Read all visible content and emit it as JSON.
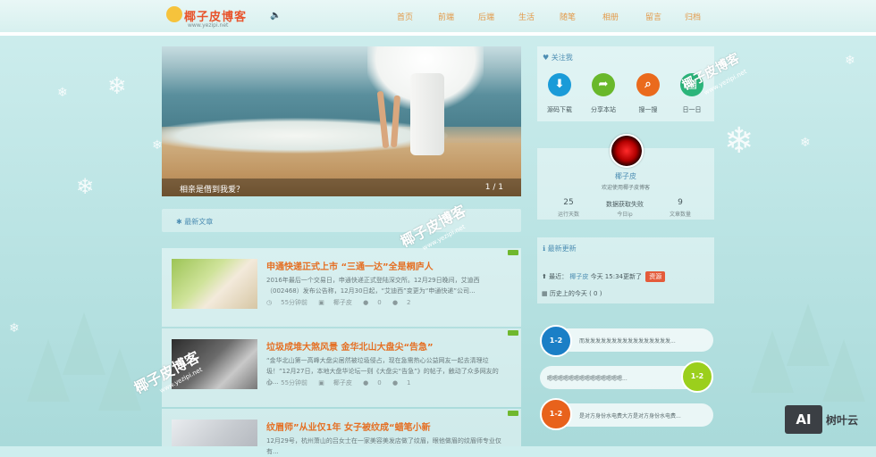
{
  "header": {
    "logo_text": "椰子皮博客",
    "logo_sub": "www.yezipi.net",
    "speaker_text": "🔈 ",
    "nav": [
      "首页",
      "前端",
      "后端",
      "生活",
      "随笔",
      "相册",
      "留言",
      "归档"
    ]
  },
  "slider": {
    "caption": "相亲是借到我爱？",
    "page": "1 / 1"
  },
  "latest": {
    "title": "最新文章"
  },
  "articles": [
    {
      "title": "申通快递正式上市 “三通一达”全是桐庐人",
      "excerpt": "2016年最后一个交易日，申通快递正式登陆深交所。12月29日晚间，艾迪西（002468）发布公告称，12月30日起，“艾迪西”变更为“申通快递”公司...",
      "time": "55分钟前",
      "author": "椰子皮",
      "comments": "0",
      "likes": "2"
    },
    {
      "title": "垃圾成堆大煞风景 金华北山大盘尖“告急”",
      "excerpt": "“金华北山第一高峰大盘尖居然被垃圾侵占，现在急需热心公益网友一起去清理垃圾！”12月27日，本地大盘华论坛一则《大盘尖“告急”》的帖子，触动了众多网友的心...",
      "time": "55分钟前",
      "author": "椰子皮",
      "comments": "0",
      "likes": "1"
    },
    {
      "title": "纹眉师”从业仅1年 女子被纹成“蜡笔小新",
      "excerpt": "12月29号，杭州萧山的吕女士在一家美容美发店做了纹眉，眼他做眉的纹眉师专业仅有...",
      "time": "",
      "author": "",
      "comments": "",
      "likes": ""
    }
  ],
  "sidebar": {
    "follow_title": "关注我",
    "follow_items": [
      {
        "label": "源码下载",
        "icon": "download-icon",
        "color": "#1a9bd8"
      },
      {
        "label": "分享本站",
        "icon": "share-icon",
        "color": "#69b82b"
      },
      {
        "label": "搜一搜",
        "icon": "search-icon",
        "color": "#ea6a1c"
      },
      {
        "label": "日一日",
        "icon": "calendar-icon",
        "color": "#2bb57a"
      }
    ],
    "profile_name": "椰子皮",
    "profile_desc": "欢迎使用椰子皮博客",
    "stats": [
      {
        "num": "25",
        "label": "运行天数"
      },
      {
        "num": "数据获取失败",
        "label": "今日ip"
      },
      {
        "num": "9",
        "label": "文章数量"
      }
    ],
    "updates_title": "最新更新",
    "update_recent_label": "最近：",
    "update_recent_who": "椰子皮",
    "update_recent_time": "今天 15:34更新了",
    "update_recent_tag": "资源",
    "update_history": "历史上的今天 ( 0 )",
    "chats": [
      {
        "num": "1-2",
        "text": "而发发发发发发发发发发发发发发发发...",
        "color": "#1b7fc6"
      },
      {
        "num": "1-2",
        "text": "嗯嗯嗯嗯嗯嗯嗯嗯嗯嗯嗯嗯嗯嗯...",
        "color": "#9bcf1c"
      },
      {
        "num": "1-2",
        "text": "是对方身份水电费大方是对方身份水电费...",
        "color": "#e8621c"
      }
    ]
  },
  "watermark": {
    "text": "椰子皮博客",
    "sub": "www.yezipi.net"
  },
  "brand": {
    "box": "AI",
    "name": "树叶云"
  }
}
